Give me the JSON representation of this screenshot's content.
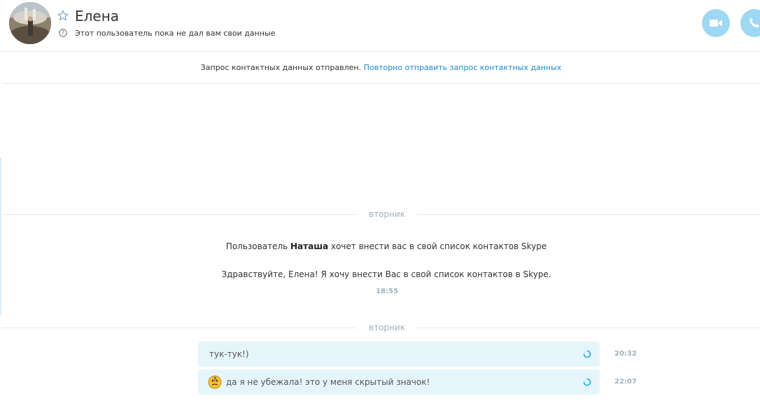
{
  "header": {
    "contact_name": "Елена",
    "status_text": "Этот пользователь пока не дал вам свои данные"
  },
  "request_bar": {
    "text": "Запрос контактных данных отправлен.",
    "link": "Повторно отправить запрос контактных данных"
  },
  "day_separators": [
    "вторник",
    "вторник"
  ],
  "system_message": {
    "prefix": "Пользователь ",
    "user": "Наташа",
    "suffix": " хочет внести вас в свой список контактов Skype",
    "greeting": "Здравствуйте, Елена! Я хочу внести Вас в свой список контактов в Skype.",
    "time": "18:55"
  },
  "messages": [
    {
      "text": "тук-тук!)",
      "time": "20:32",
      "emoji": false
    },
    {
      "text": "да я не убежала! это у меня скрытый значок!",
      "time": "22:07",
      "emoji": true
    }
  ],
  "colors": {
    "accent": "#1b88c8",
    "call_button": "#9ed8f3",
    "bubble": "#e6f5fc",
    "muted": "#a0b3bf"
  },
  "icons": {
    "favorite": "star-icon",
    "status": "help-icon",
    "video": "video-camera-icon",
    "audio": "phone-icon",
    "sending": "sending-spinner-icon",
    "emoji": "confused-emoji-icon"
  }
}
